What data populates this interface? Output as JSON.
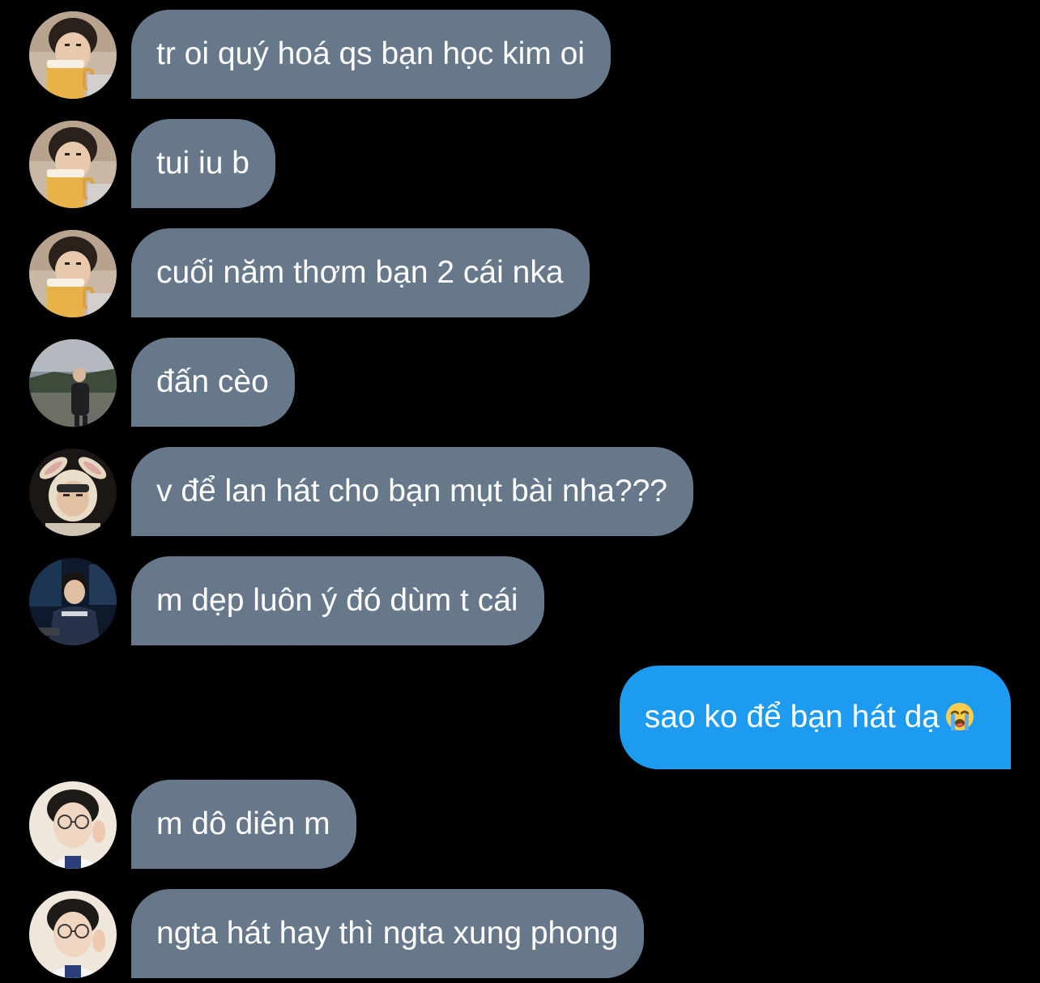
{
  "conversation": {
    "messages": [
      {
        "text": "tr oi quý hoá qs bạn học kim oi",
        "direction": "incoming",
        "avatar": "avatar-user-beer"
      },
      {
        "text": "tui iu b",
        "direction": "incoming",
        "avatar": "avatar-user-beer"
      },
      {
        "text": "cuối năm thơm bạn 2 cái nka",
        "direction": "incoming",
        "avatar": "avatar-user-beer"
      },
      {
        "text": "đấn cèo",
        "direction": "incoming",
        "avatar": "avatar-user-outdoor"
      },
      {
        "text": "v để lan hát cho bạn mụt bài nha???",
        "direction": "incoming",
        "avatar": "avatar-user-bunny-ears"
      },
      {
        "text": "m dẹp luôn ý đó dùm t cái",
        "direction": "incoming",
        "avatar": "avatar-user-jersey"
      },
      {
        "text": "sao ko để bạn hát dạ",
        "direction": "outgoing",
        "emoji": "loudly-crying-face-icon"
      },
      {
        "text": "m dô diên m",
        "direction": "incoming",
        "avatar": "avatar-user-glasses"
      },
      {
        "text": "ngta hát hay thì ngta xung phong",
        "direction": "incoming",
        "avatar": "avatar-user-glasses"
      }
    ]
  },
  "colors": {
    "background": "#000000",
    "incoming_bubble": "#66788a",
    "outgoing_bubble": "#1d9bf0",
    "bubble_text": "#ffffff"
  }
}
